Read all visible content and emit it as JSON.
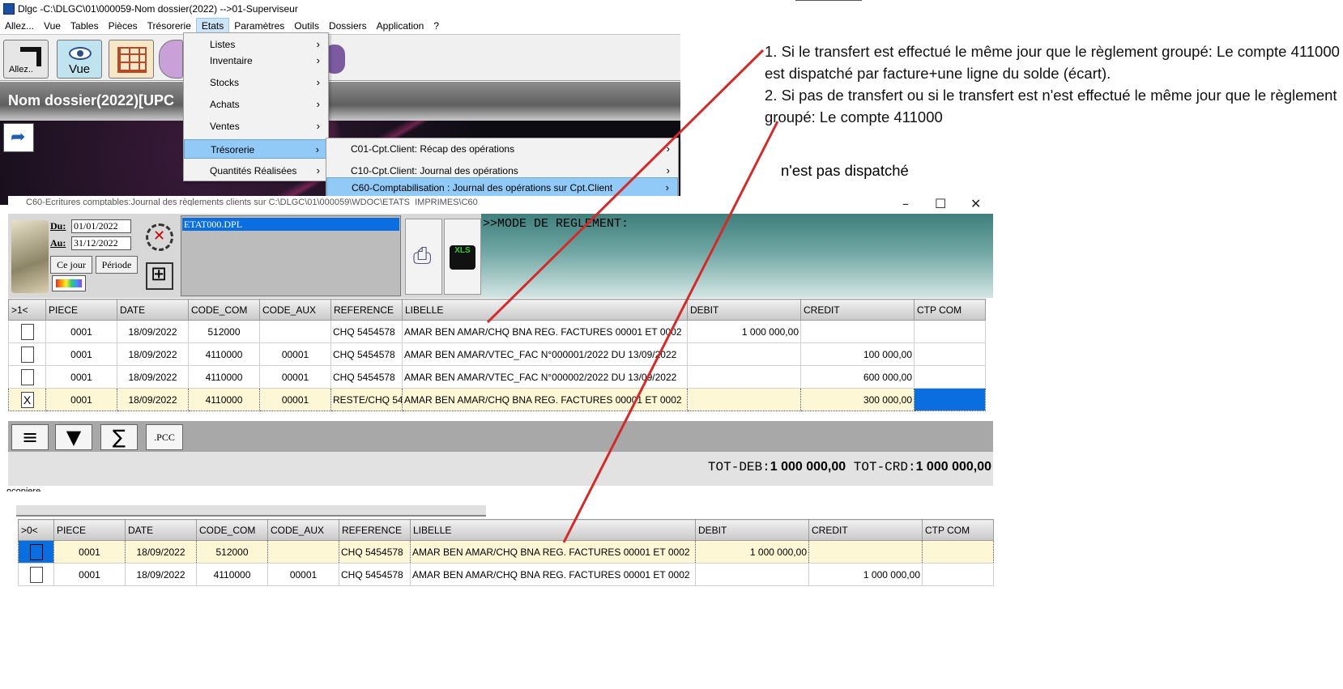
{
  "window": {
    "title": "Dlgc -C:\\DLGC\\01\\000059-Nom dossier(2022) -->01-Superviseur",
    "dossier_header": "Nom dossier(2022)[UPC"
  },
  "menubar": [
    "Allez...",
    "Vue",
    "Tables",
    "Pièces",
    "Trésorerie",
    "Etats",
    "Paramètres",
    "Outils",
    "Dossiers",
    "Application",
    "?"
  ],
  "toolbar": {
    "allez_label": "Allez..",
    "vue_label": "Vue"
  },
  "etats_menu": [
    "Listes",
    "Inventaire",
    "Stocks",
    "Achats",
    "Ventes",
    "Trésorerie",
    "Quantités Réalisées"
  ],
  "tresorerie_submenu": [
    "C01-Cpt.Client: Récap des opérations",
    "C10-Cpt.Client: Journal des opérations",
    "C60-Comptabilisation : Journal des opérations sur Cpt.Client"
  ],
  "child_window": {
    "title": "C60-Ecritures comptables:Journal des règlements clients sur C:\\DLGC\\01\\000059\\WDOC\\ETATS_IMPRIMES\\C60",
    "du_label": "Du:",
    "du_value": "01/01/2022",
    "au_label": "Au:",
    "au_value": "31/12/2022",
    "ce_jour_label": "Ce jour",
    "periode_label": "Période",
    "file_selected": "ETAT000.DPL",
    "mode_text": ">>MODE DE REGLEMENT:",
    "xls_label": "XLS",
    "pcc_label": ".PCC",
    "tot_deb_label": "TOT-DEB:",
    "tot_deb_value": "1 000 000,00",
    "tot_crd_label": "TOT-CRD:",
    "tot_crd_value": "1 000 000,00",
    "status_text": "ocopiere"
  },
  "grid1": {
    "columns": [
      ">1<",
      "PIECE",
      "DATE",
      "CODE_COM",
      "CODE_AUX",
      "REFERENCE",
      "LIBELLE",
      "DEBIT",
      "CREDIT",
      "CTP COM"
    ],
    "rows": [
      {
        "check": "",
        "piece": "0001",
        "date": "18/09/2022",
        "code_com": "512000",
        "code_aux": "",
        "reference": "CHQ 5454578",
        "libelle": "AMAR BEN AMAR/CHQ BNA REG. FACTURES 00001 ET 0002",
        "debit": "1 000 000,00",
        "credit": "",
        "ctp": ""
      },
      {
        "check": "",
        "piece": "0001",
        "date": "18/09/2022",
        "code_com": "4110000",
        "code_aux": "00001",
        "reference": "CHQ 5454578",
        "libelle": "AMAR BEN AMAR/VTEC_FAC N°000001/2022 DU 13/09/2022",
        "debit": "",
        "credit": "100 000,00",
        "ctp": ""
      },
      {
        "check": "",
        "piece": "0001",
        "date": "18/09/2022",
        "code_com": "4110000",
        "code_aux": "00001",
        "reference": "CHQ 5454578",
        "libelle": "AMAR BEN AMAR/VTEC_FAC N°000002/2022 DU 13/09/2022",
        "debit": "",
        "credit": "600 000,00",
        "ctp": ""
      },
      {
        "check": "X",
        "piece": "0001",
        "date": "18/09/2022",
        "code_com": "4110000",
        "code_aux": "00001",
        "reference": "RESTE/CHQ 5454578",
        "libelle": "AMAR BEN AMAR/CHQ BNA REG. FACTURES 00001 ET 0002",
        "debit": "",
        "credit": "300 000,00",
        "ctp": ""
      }
    ]
  },
  "grid2": {
    "columns": [
      ">0<",
      "PIECE",
      "DATE",
      "CODE_COM",
      "CODE_AUX",
      "REFERENCE",
      "LIBELLE",
      "DEBIT",
      "CREDIT",
      "CTP COM"
    ],
    "rows": [
      {
        "check": "",
        "piece": "0001",
        "date": "18/09/2022",
        "code_com": "512000",
        "code_aux": "",
        "reference": "CHQ 5454578",
        "libelle": "AMAR BEN AMAR/CHQ BNA REG. FACTURES 00001 ET 0002",
        "debit": "1 000 000,00",
        "credit": "",
        "ctp": ""
      },
      {
        "check": "",
        "piece": "0001",
        "date": "18/09/2022",
        "code_com": "4110000",
        "code_aux": "00001",
        "reference": "CHQ 5454578",
        "libelle": "AMAR BEN AMAR/CHQ BNA REG. FACTURES 00001 ET 0002",
        "debit": "",
        "credit": "1 000 000,00",
        "ctp": ""
      }
    ]
  },
  "notes": {
    "p1": "1. Si le transfert est effectué le même jour que le règlement groupé: Le compte 411000 est dispatché par facture+une ligne du solde (écart).",
    "p2": "2. Si pas de transfert ou si le transfert est n'est effectué le même jour que le règlement groupé: Le compte 411000",
    "p3": "n'est pas dispatché"
  },
  "colors": {
    "selection_blue": "#0a6ee0",
    "menu_highlight": "#91c9f7",
    "annotation_line": "#d42a2a",
    "selected_row": "#fdf7d6"
  },
  "icons": [
    "allez-arrow-icon",
    "eye-icon",
    "tables-icon",
    "clip-icon",
    "phone-icon",
    "shortcut-arrow-icon",
    "money-icon",
    "gear-icon",
    "target-icon",
    "print-preview-icon",
    "xls-icon",
    "menu-lines-icon",
    "filter-icon",
    "sigma-icon"
  ]
}
